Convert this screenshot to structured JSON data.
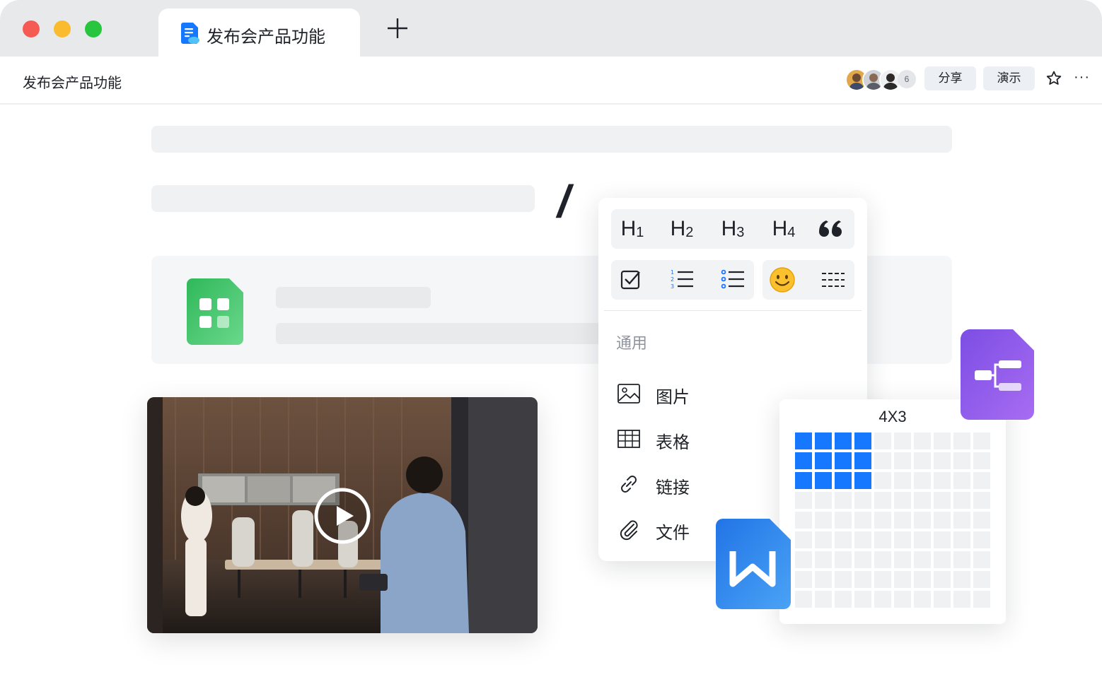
{
  "window": {
    "tab_title": "发布会产品功能",
    "new_tab_icon": "plus-icon"
  },
  "header": {
    "doc_title": "发布会产品功能",
    "collaborator_count": "6",
    "share_label": "分享",
    "present_label": "演示",
    "more_label": "···"
  },
  "editor": {
    "slash_char": "/"
  },
  "slash_menu": {
    "headings": [
      {
        "h": "H",
        "n": "1"
      },
      {
        "h": "H",
        "n": "2"
      },
      {
        "h": "H",
        "n": "3"
      },
      {
        "h": "H",
        "n": "4"
      }
    ],
    "quote_glyph": "66",
    "section_label": "通用",
    "items": [
      {
        "label": "图片",
        "icon": "image-icon"
      },
      {
        "label": "表格",
        "icon": "table-icon"
      },
      {
        "label": "链接",
        "icon": "link-icon"
      },
      {
        "label": "文件",
        "icon": "attachment-icon"
      }
    ]
  },
  "table_picker": {
    "label": "4X3",
    "cols": 10,
    "rows": 9,
    "selected_cols": 4,
    "selected_rows": 3
  },
  "colors": {
    "accent": "#1677ff",
    "sheet_green": "#34c15b",
    "mind_purple": "#8a4ee8",
    "word_blue": "#2b7de9"
  }
}
